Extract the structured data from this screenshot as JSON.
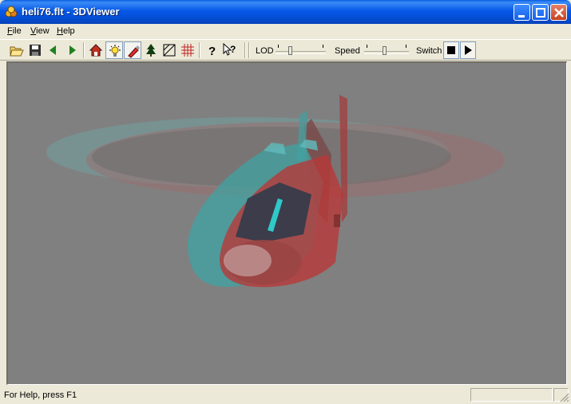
{
  "window": {
    "title": "heli76.flt - 3DViewer"
  },
  "menu": {
    "items": [
      {
        "key": "F",
        "rest": "ile"
      },
      {
        "key": "V",
        "rest": "iew"
      },
      {
        "key": "H",
        "rest": "elp"
      }
    ]
  },
  "toolbar": {
    "buttons": [
      "open-icon",
      "save-icon",
      "back-arrow-icon",
      "forward-arrow-icon",
      "home-icon",
      "light-icon",
      "paint-icon",
      "tree-icon",
      "wireframe-icon",
      "grid-icon",
      "help-icon",
      "context-help-icon"
    ],
    "lod_label": "LOD",
    "speed_label": "Speed",
    "switch_label": "Switch",
    "lod_level": 0.25,
    "speed_level": 0.45
  },
  "viewport": {
    "background": "#808080",
    "scene": "anaglyph-helicopter"
  },
  "status": {
    "text": "For Help, press F1"
  },
  "colors": {
    "titlebar": "#0758e8",
    "red_channel": "#c82828",
    "cyan_channel": "#28b4b4"
  }
}
